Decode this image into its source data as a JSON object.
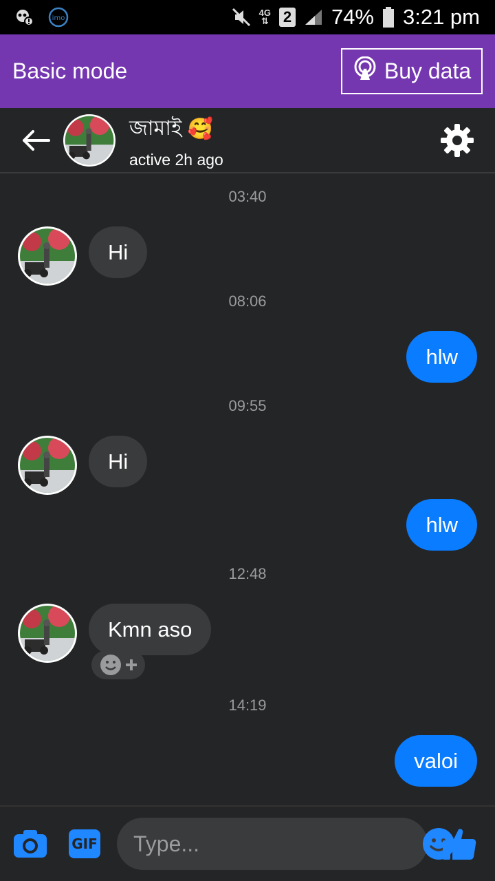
{
  "status_bar": {
    "battery": "74%",
    "time": "3:21 pm",
    "network": "4G",
    "sim": "2",
    "left_app_icon": "imo"
  },
  "mode_bar": {
    "title": "Basic mode",
    "buy_label": "Buy data"
  },
  "chat_header": {
    "name": "জামাই",
    "name_emoji": "🥰",
    "status": "active 2h ago"
  },
  "messages": [
    {
      "type": "timestamp",
      "text": "03:40"
    },
    {
      "type": "incoming",
      "text": "Hi"
    },
    {
      "type": "timestamp",
      "text": "08:06"
    },
    {
      "type": "outgoing",
      "text": "hlw"
    },
    {
      "type": "timestamp",
      "text": "09:55"
    },
    {
      "type": "incoming",
      "text": "Hi"
    },
    {
      "type": "outgoing",
      "text": "hlw"
    },
    {
      "type": "timestamp",
      "text": "12:48"
    },
    {
      "type": "incoming",
      "text": "Kmn aso"
    },
    {
      "type": "timestamp",
      "text": "14:19"
    },
    {
      "type": "outgoing",
      "text": "valoi"
    }
  ],
  "composer": {
    "placeholder": "Type...",
    "gif_label": "GIF"
  },
  "colors": {
    "mode_bar": "#7437b0",
    "outgoing_bubble": "#0a7cff",
    "incoming_bubble": "#3a3b3c",
    "background": "#242526",
    "accent": "#1f87ff"
  }
}
